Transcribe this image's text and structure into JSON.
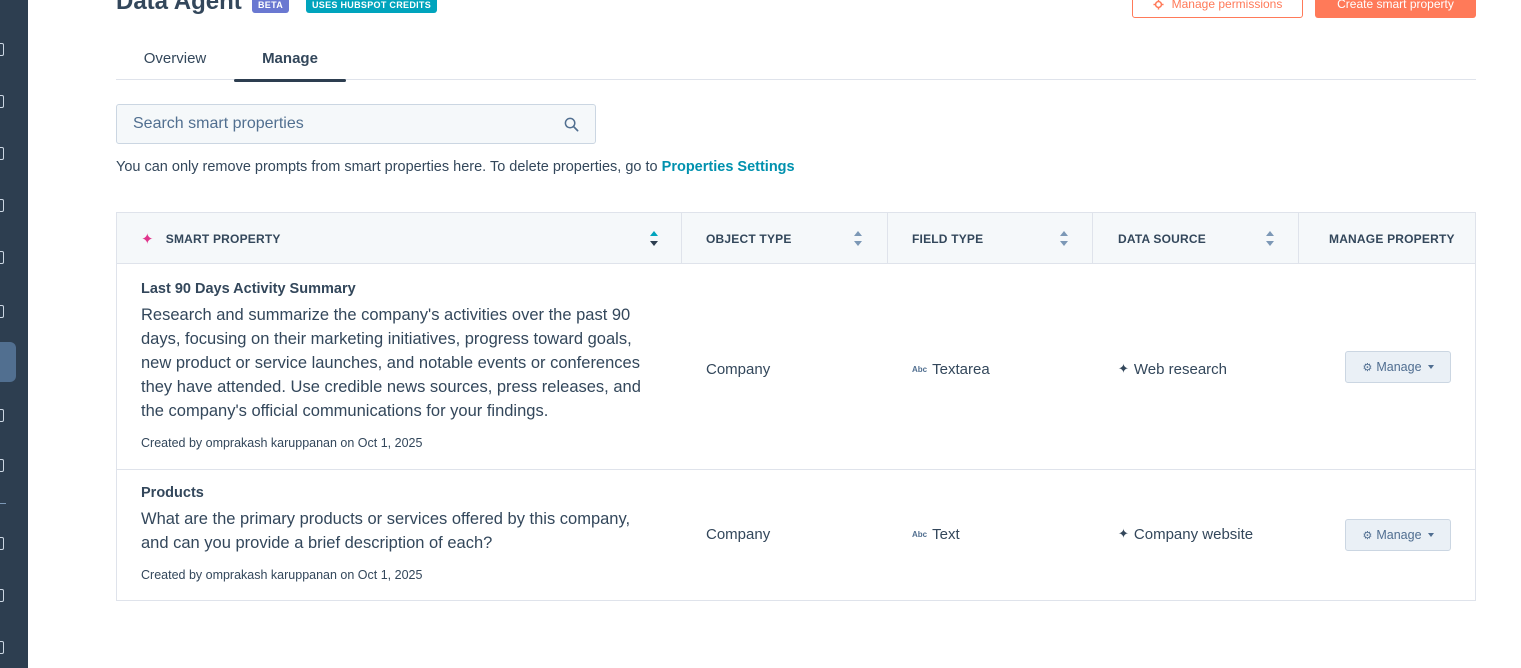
{
  "header": {
    "title": "Data Agent",
    "badge_beta": "BETA",
    "badge_credits": "USES HUBSPOT CREDITS",
    "manage_permissions": "Manage permissions",
    "create_smart_property": "Create smart property"
  },
  "tabs": [
    {
      "label": "Overview",
      "active": false
    },
    {
      "label": "Manage",
      "active": true
    }
  ],
  "search": {
    "placeholder": "Search smart properties",
    "value": ""
  },
  "notice": {
    "text": "You can only remove prompts from smart properties here. To delete properties, go to",
    "link": "Properties Settings"
  },
  "table": {
    "columns": [
      "SMART PROPERTY",
      "OBJECT TYPE",
      "FIELD TYPE",
      "DATA SOURCE",
      "MANAGE PROPERTY"
    ],
    "rows": [
      {
        "name": "Last 90 Days Activity Summary",
        "prompt": "Research and summarize the company's activities over the past 90 days, focusing on their marketing initiatives, progress toward goals, new product or service launches, and notable events or conferences they have attended. Use credible news sources, press releases, and the company's official communications for your findings.",
        "meta": "Created by omprakash karuppanan on Oct 1, 2025",
        "object_type": "Company",
        "field_type_icon": "Abc",
        "field_type": "Textarea",
        "data_source": "Web research",
        "manage": "Manage"
      },
      {
        "name": "Products",
        "prompt": "What are the primary products or services offered by this company, and can you provide a brief description of each?",
        "meta": "Created by omprakash karuppanan on Oct 1, 2025",
        "object_type": "Company",
        "field_type_icon": "Abc",
        "field_type": "Text",
        "data_source": "Company website",
        "manage": "Manage"
      }
    ]
  },
  "colors": {
    "accent_orange": "#ff7a59",
    "link_teal": "#0091ae",
    "beta_badge": "#6a78d1",
    "credits_badge": "#00a4bd",
    "sidebar": "#2d3e50"
  },
  "icons": [
    "gear-icon",
    "search-icon",
    "sparkle-icon",
    "sort-icon",
    "ai-sparkle-icon",
    "caret-down-icon"
  ]
}
